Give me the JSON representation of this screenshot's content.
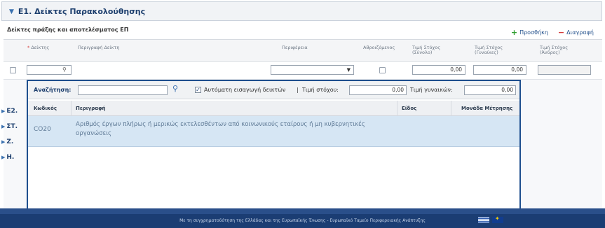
{
  "section": {
    "title": "Ε1. Δείκτες Παρακολούθησης"
  },
  "subsection": {
    "title": "Δείκτες πράξης και αποτελέσματος ΕΠ"
  },
  "actions": {
    "add_label": "Προσθήκη",
    "delete_label": "Διαγραφή"
  },
  "grid": {
    "headers": {
      "indicator": "Δείκτης",
      "description": "Περιγραφή Δείκτη",
      "region": "Περιφέρεια",
      "cumulative": "Αθροιζόμενος",
      "target_total": [
        "Τιμή Στόχος",
        "(Σύνολο)"
      ],
      "target_women": [
        "Τιμή Στόχος",
        "(Γυναίκες)"
      ],
      "target_men": [
        "Τιμή Στόχος",
        "(Άνδρες)"
      ]
    },
    "edit_row": {
      "target_total": "0,00",
      "target_women": "0,00"
    }
  },
  "collapsed_sections": [
    "Ε2.",
    "ΣΤ.",
    "Ζ.",
    "Η."
  ],
  "popup": {
    "search_label": "Αναζήτηση:",
    "auto_insert_label": "Αυτόματη εισαγωγή δεικτών",
    "target_value_label": "Τιμή στόχου:",
    "target_value": "0,00",
    "women_value_label": "Τιμή γυναικών:",
    "women_value": "0,00",
    "columns": {
      "code": "Κωδικός",
      "description": "Περιγραφή",
      "type": "Είδος",
      "unit": "Μονάδα Μέτρησης"
    },
    "rows": [
      {
        "code": "CO20",
        "description": "Αριθμός έργων πλήρως ή μερικώς εκτελεσθέντων από κοινωνικούς εταίρους ή μη κυβερνητικές οργανώσεις",
        "type": "",
        "unit": ""
      }
    ]
  },
  "footer": {
    "text": "Με τη συγχρηματοδότηση της Ελλάδας και της Ευρωπαϊκής Ένωσης - Ευρωπαϊκό Ταμείο Περιφερειακής Ανάπτυξης"
  },
  "colors": {
    "brand": "#1e4f8e",
    "selected_row": "#d6e6f4",
    "add": "#2f9e2f",
    "delete": "#d43a3a"
  }
}
